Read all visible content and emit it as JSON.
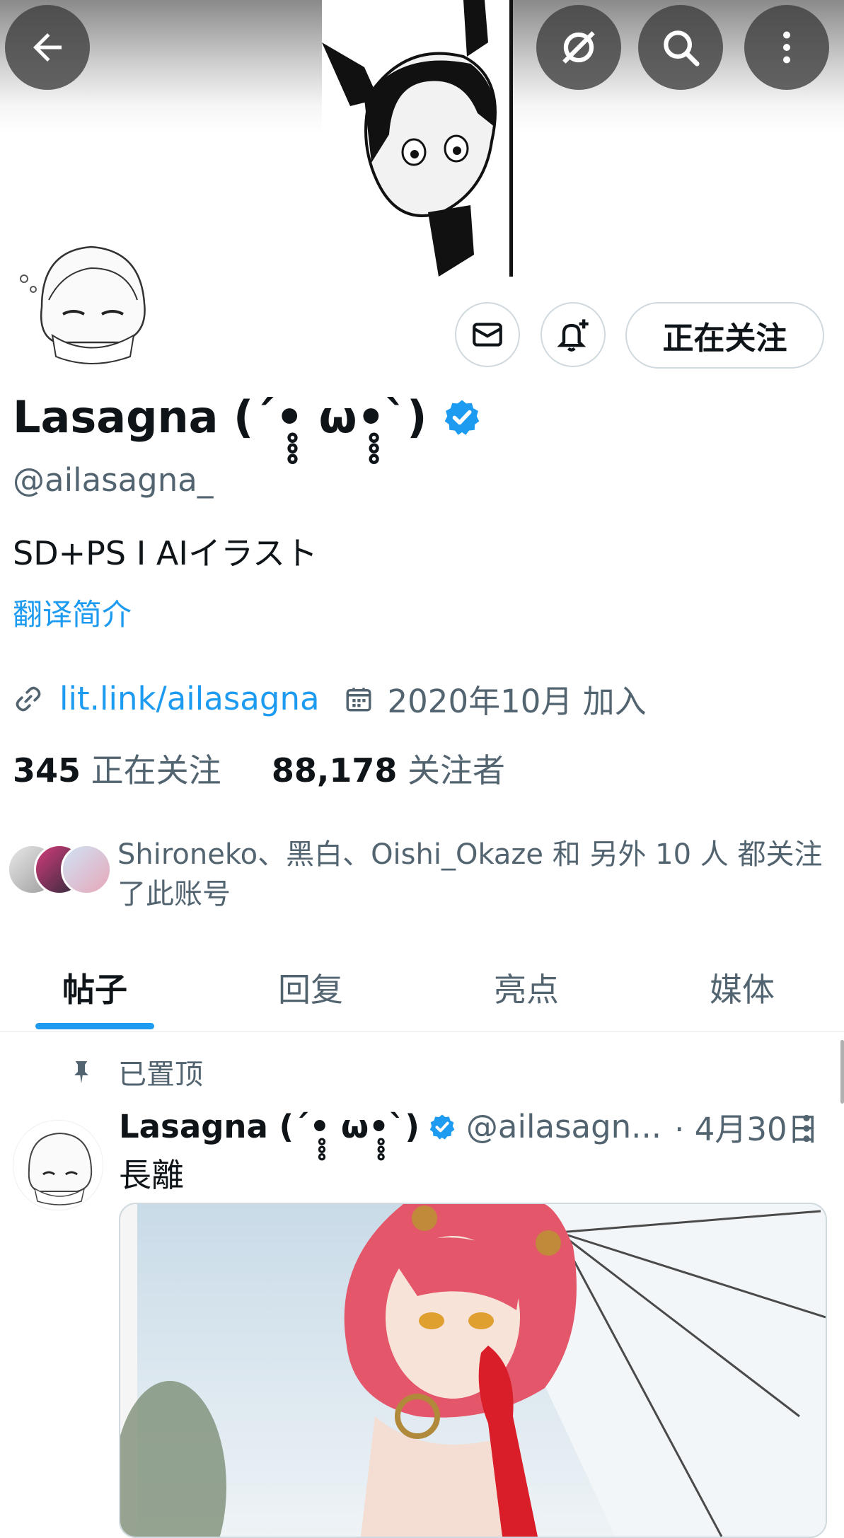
{
  "header": {
    "back_icon": "arrow-left-icon",
    "buttons": [
      "no-sync-icon",
      "search-icon",
      "more-vertical-icon"
    ]
  },
  "profile": {
    "name": "Lasagna (´•̥̥̥ ω•̥̥̥`)",
    "handle": "@ailasagna_",
    "bio": "SD+PS I AIイラスト",
    "translate_label": "翻译简介",
    "link": "lit.link/ailasagna",
    "joined": "2020年10月 加入",
    "following_count": "345",
    "following_label": "正在关注",
    "followers_count": "88,178",
    "followers_label": "关注者",
    "follow_button": "正在关注",
    "mutual_text": "Shironeko、黑白、Oishi_Okaze 和 另外 10 人 都关注了此账号"
  },
  "tabs": [
    "帖子",
    "回复",
    "亮点",
    "媒体"
  ],
  "pinned_post": {
    "pinned_label": "已置顶",
    "author_name": "Lasagna (´•̥̥̥ ω•̥̥̥`)",
    "author_handle": "@ailasagn...",
    "date": "· 4月30日",
    "text": "長離"
  },
  "colors": {
    "accent": "#1d9bf0",
    "text": "#0f1419",
    "secondary": "#536471"
  }
}
